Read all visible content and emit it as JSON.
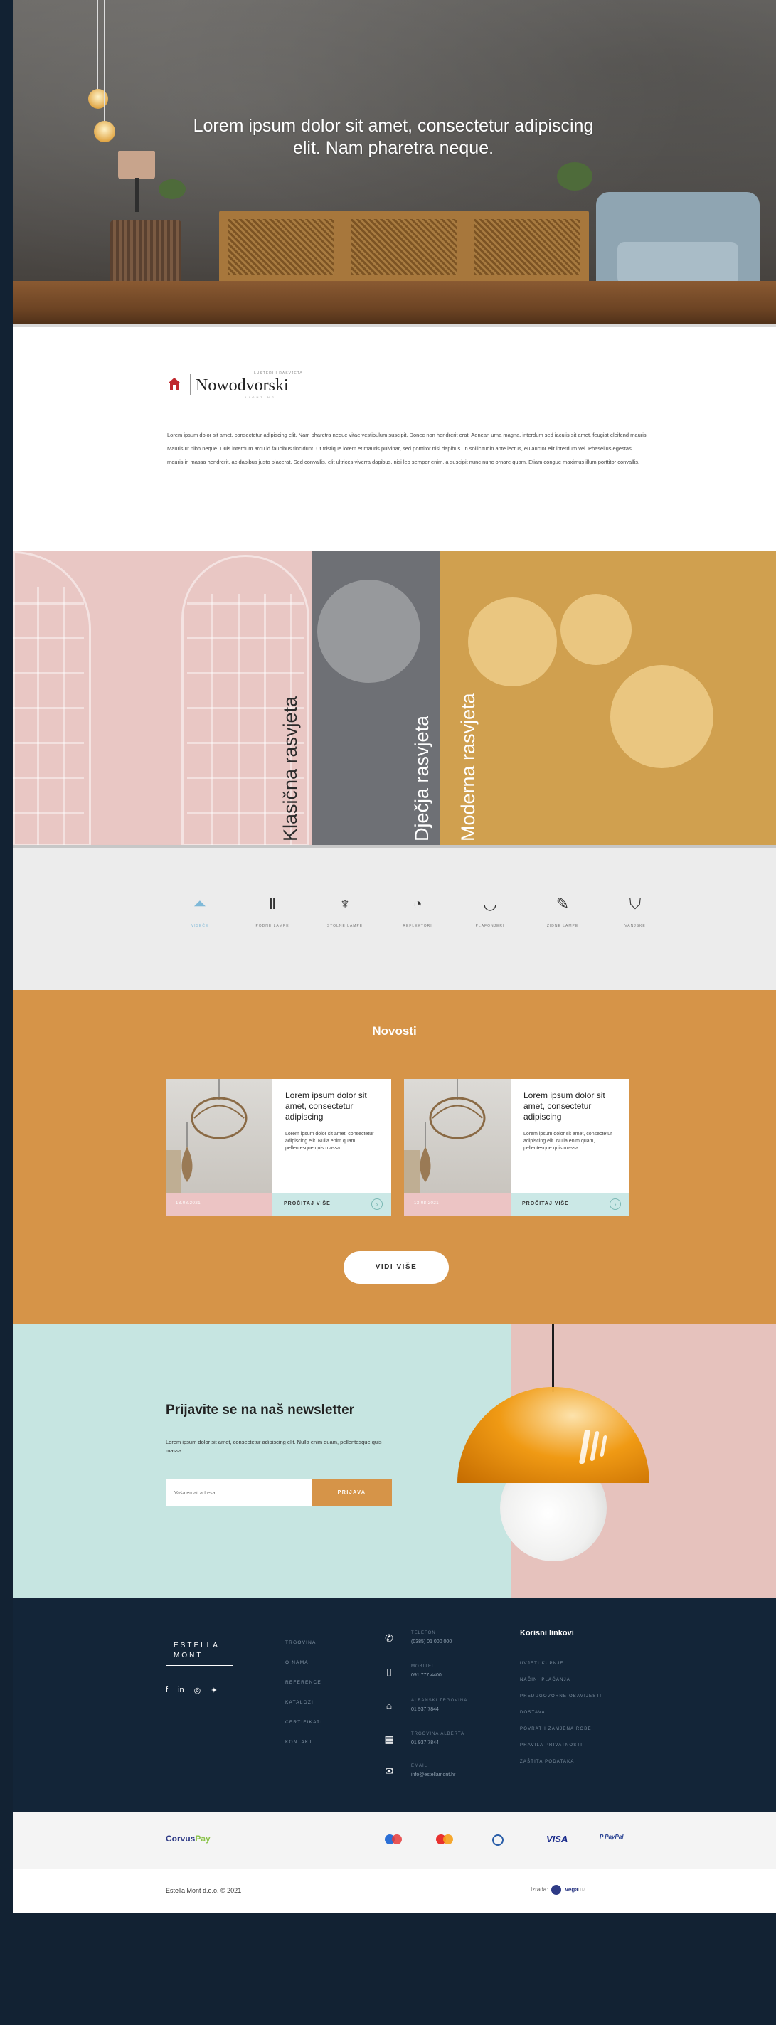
{
  "hero": {
    "headline": "Lorem ipsum dolor sit amet, consectetur adipiscing elit. Nam pharetra neque."
  },
  "brand": {
    "logo_tag": "LUSTERI I RASVJETA",
    "logo_name": "Nowodvorski",
    "logo_sub": "LIGHTING",
    "intro": "Lorem ipsum dolor sit amet, consectetur adipiscing elit. Nam pharetra neque vitae vestibulum suscipit. Donec non hendrerit erat. Aenean urna magna, interdum sed iaculis sit amet, feugiat eleifend mauris. Mauris ut nibh neque. Duis interdum arcu id faucibus tincidunt. Ut tristique lorem et mauris pulvinar, sed porttitor nisi dapibus. In sollicitudin ante lectus, eu auctor elit interdum vel. Phasellus egestas mauris in massa hendrerit, ac dapibus justo placerat. Sed convallis, elit ultrices viverra dapibus, nisi leo semper enim, a suscipit nunc nunc ornare quam. Etiam congue maximus illum porttitor convallis."
  },
  "categories": [
    {
      "label": "Klasična rasvjeta"
    },
    {
      "label": "Dječja rasvjeta"
    },
    {
      "label": "Moderna rasvjeta"
    }
  ],
  "icon_nav": [
    {
      "icon": "ceiling-lamp-icon",
      "glyph": "⏶",
      "label": "VISEĆE"
    },
    {
      "icon": "floor-lamp-icon",
      "glyph": "Ⅱ",
      "label": "PODNE LAMPE"
    },
    {
      "icon": "table-lamp-icon",
      "glyph": "♆",
      "label": "STOLNE LAMPE"
    },
    {
      "icon": "spotlight-icon",
      "glyph": "◔",
      "label": "REFLEKTORI"
    },
    {
      "icon": "ceiling-light-icon",
      "glyph": "◡",
      "label": "PLAFONJERI"
    },
    {
      "icon": "wall-light-icon",
      "glyph": "✎",
      "label": "ZIDNE LAMPE"
    },
    {
      "icon": "outdoor-light-icon",
      "glyph": "⛉",
      "label": "VANJSKE"
    }
  ],
  "news": {
    "title": "Novosti",
    "cards": [
      {
        "heading": "Lorem ipsum dolor sit amet, consectetur adipiscing",
        "text": "Lorem ipsum dolor sit amet, consectetur adipiscing elit. Nulla enim quam, pellentesque quis massa...",
        "date": "13.08.2021",
        "read_more": "PROČITAJ VIŠE"
      },
      {
        "heading": "Lorem ipsum dolor sit amet, consectetur adipiscing",
        "text": "Lorem ipsum dolor sit amet, consectetur adipiscing elit. Nulla enim quam, pellentesque quis massa...",
        "date": "13.08.2021",
        "read_more": "PROČITAJ VIŠE"
      }
    ],
    "more_button": "VIDI VIŠE"
  },
  "newsletter": {
    "title": "Prijavite se na naš newsletter",
    "text": "Lorem ipsum dolor sit amet, consectetur adipiscing elit. Nulla enim quam, pellentesque quis massa...",
    "input_placeholder": "Vaša email adresa",
    "button": "PRIJAVA"
  },
  "footer": {
    "logo_line1": "ESTELLA",
    "logo_line2": "MONT",
    "social": [
      "f",
      "in",
      "◎",
      "✦"
    ],
    "menu": [
      "TRGOVINA",
      "O NAMA",
      "REFERENCE",
      "KATALOZI",
      "CERTIFIKATI",
      "KONTAKT"
    ],
    "contacts": [
      {
        "icon": "phone-icon",
        "glyph": "✆",
        "title": "TELEFON",
        "value": "(0385) 01 000 000"
      },
      {
        "icon": "mobile-icon",
        "glyph": "▯",
        "title": "MOBITEL",
        "value": "091 777 4400"
      },
      {
        "icon": "store-icon",
        "glyph": "⌂",
        "title": "ALBANSKI TRGOVINA",
        "value": "01 937 7844"
      },
      {
        "icon": "building-icon",
        "glyph": "▦",
        "title": "TRGOVINA ALBERTA",
        "value": "01 937 7844"
      },
      {
        "icon": "mail-icon",
        "glyph": "✉",
        "title": "EMAIL",
        "value": "info@estellamont.hr"
      }
    ],
    "useful_title": "Korisni linkovi",
    "useful": [
      "UVJETI KUPNJE",
      "NAČINI PLAĆANJA",
      "PREDUGOVORNE OBAVIJESTI",
      "DOSTAVA",
      "POVRAT I ZAMJENA ROBE",
      "PRAVILA PRIVATNOSTI",
      "ZAŠTITA PODATAKA"
    ]
  },
  "payment": {
    "corvus_a": "Corvus",
    "corvus_b": "Pay",
    "cards": [
      "Maestro",
      "Mastercard",
      "Diners",
      "VISA",
      "PayPal"
    ]
  },
  "copyright": {
    "left": "Estella Mont d.o.o. © 2021",
    "made_by": "Izrada:",
    "agency": "vega",
    "agency_suffix": "ITM"
  }
}
